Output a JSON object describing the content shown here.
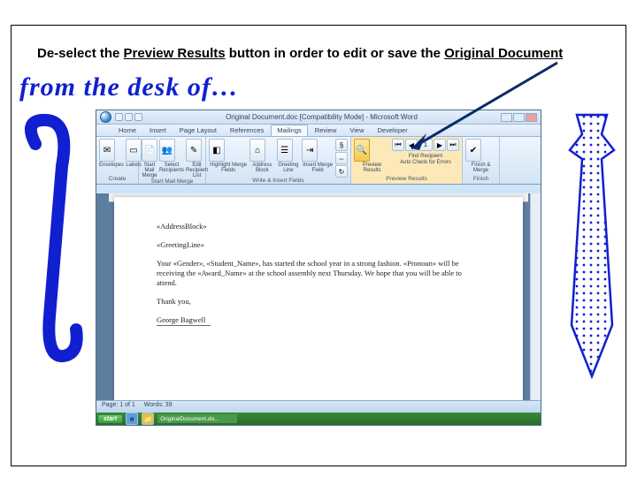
{
  "instruction": {
    "pre": "De-select the ",
    "btn": "Preview Results",
    "mid": " button in order to edit or save the ",
    "doc": "Original Document"
  },
  "decor": {
    "desk_of": "from the desk of…"
  },
  "word": {
    "title": "Original Document.doc [Compatibility Mode] - Microsoft Word",
    "tabs": [
      "Home",
      "Insert",
      "Page Layout",
      "References",
      "Mailings",
      "Review",
      "View",
      "Developer"
    ],
    "active_tab": 4,
    "groups": {
      "create": "Create",
      "start": "Start Mail Merge",
      "write": "Write & Insert Fields",
      "preview": "Preview Results",
      "finish": "Finish"
    },
    "buttons": {
      "envelopes": "Envelopes",
      "labels": "Labels",
      "start_merge": "Start Mail Merge",
      "select_rec": "Select Recipients",
      "edit_rec": "Edit Recipient List",
      "highlight": "Highlight Merge Fields",
      "addr_block": "Address Block",
      "greeting": "Greeting Line",
      "insert_field": "Insert Merge Field",
      "rules": "Rules",
      "match": "Match Fields",
      "update": "Update Labels",
      "preview": "Preview Results",
      "find_rec": "Find Recipient",
      "auto_check": "Auto Check for Errors",
      "finish": "Finish & Merge"
    },
    "nav": {
      "pos": "1"
    },
    "status": {
      "page": "Page: 1 of 1",
      "words": "Words: 39"
    },
    "taskbar": {
      "start": "start",
      "doc": "OriginalDocument.do..."
    }
  },
  "document": {
    "addr": "«AddressBlock»",
    "greet": "«GreetingLine»",
    "body": "Your «Gender», «Student_Name», has started the school year in a strong fashion. «Pronoun» will be receiving the «Award_Name» at the school assembly next Thursday. We hope that you will be able to attend.",
    "thanks": "Thank you,",
    "sig": "George Bagwell"
  }
}
